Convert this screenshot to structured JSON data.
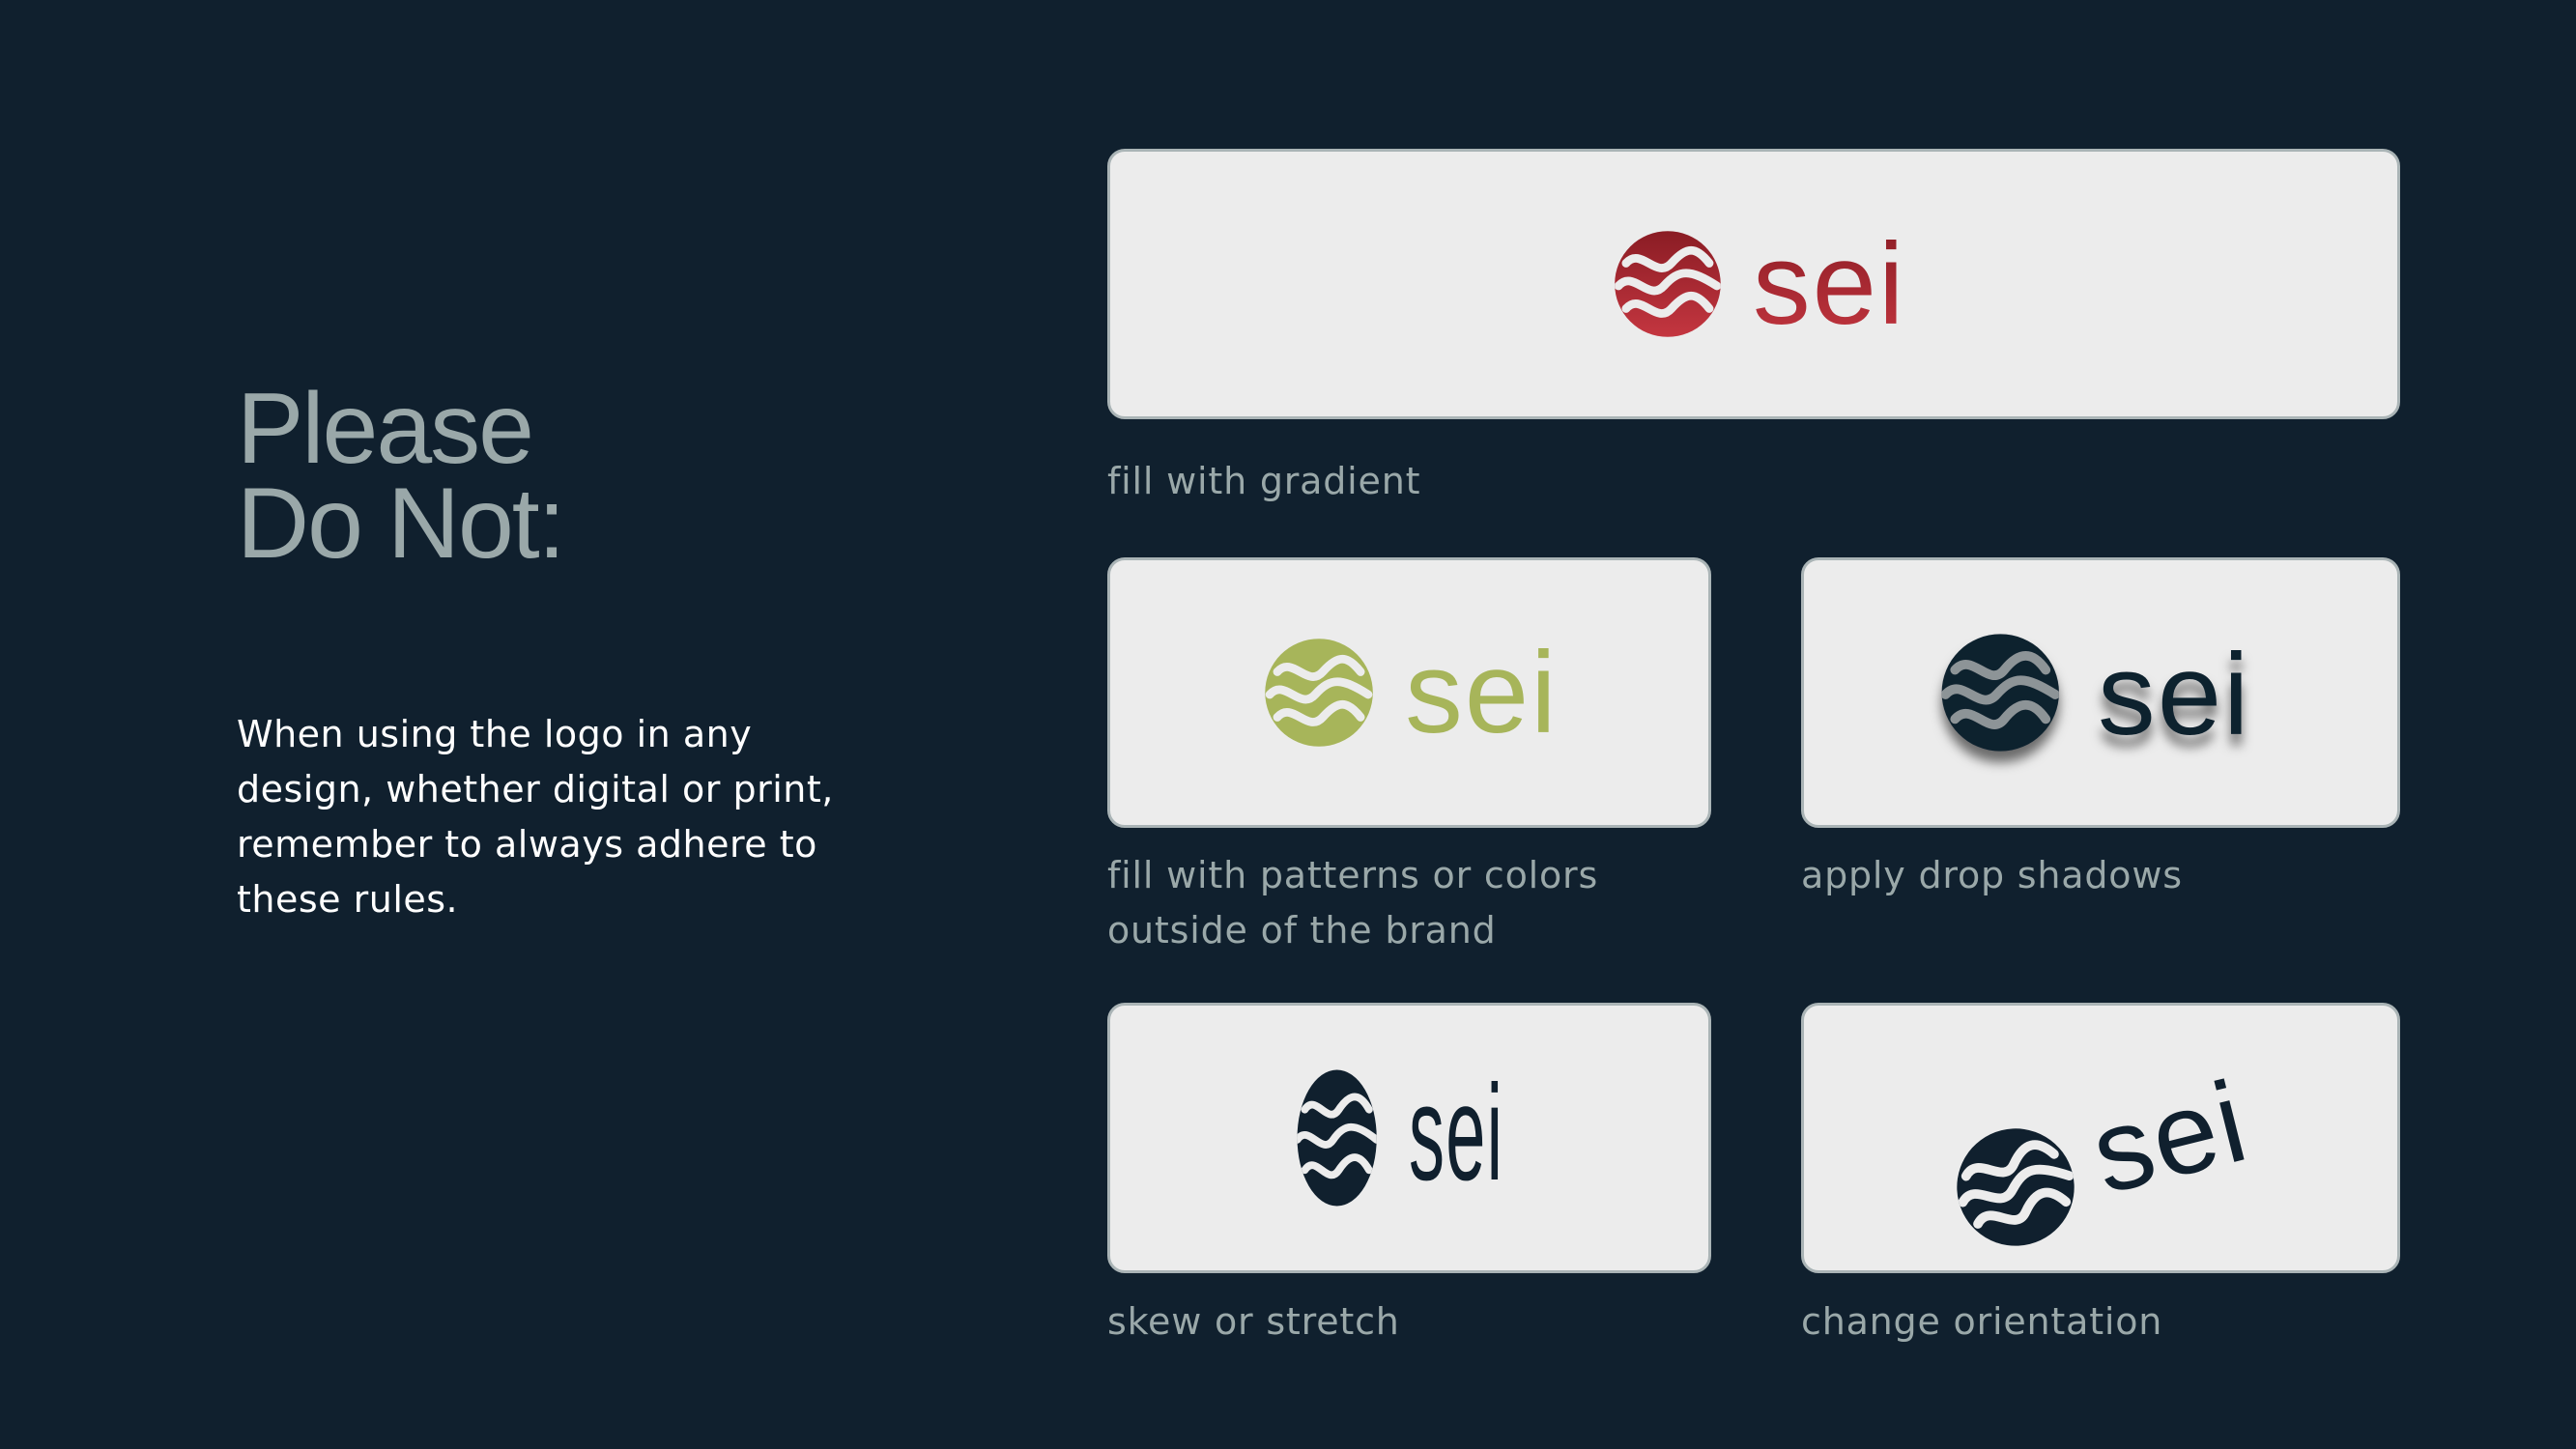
{
  "heading": {
    "line1": "Please",
    "line2": "Do Not:"
  },
  "intro_text": "When using the logo in any design, whether digital or print, remember to always adhere to these rules.",
  "brand_wordmark": "sei",
  "colors": {
    "background": "#10202e",
    "card": "#ececec",
    "brand_navy": "#10202e",
    "gradient_start": "#8a1c24",
    "gradient_end": "#c43640",
    "off_brand_green": "#a7b55a",
    "muted_text": "#9aa8a9"
  },
  "examples": [
    {
      "id": "gradient",
      "caption": "fill with gradient"
    },
    {
      "id": "colors",
      "caption": "fill with patterns or colors outside of the brand"
    },
    {
      "id": "shadow",
      "caption": "apply drop shadows"
    },
    {
      "id": "skew",
      "caption": "skew or stretch"
    },
    {
      "id": "rotate",
      "caption": "change orientation"
    }
  ]
}
